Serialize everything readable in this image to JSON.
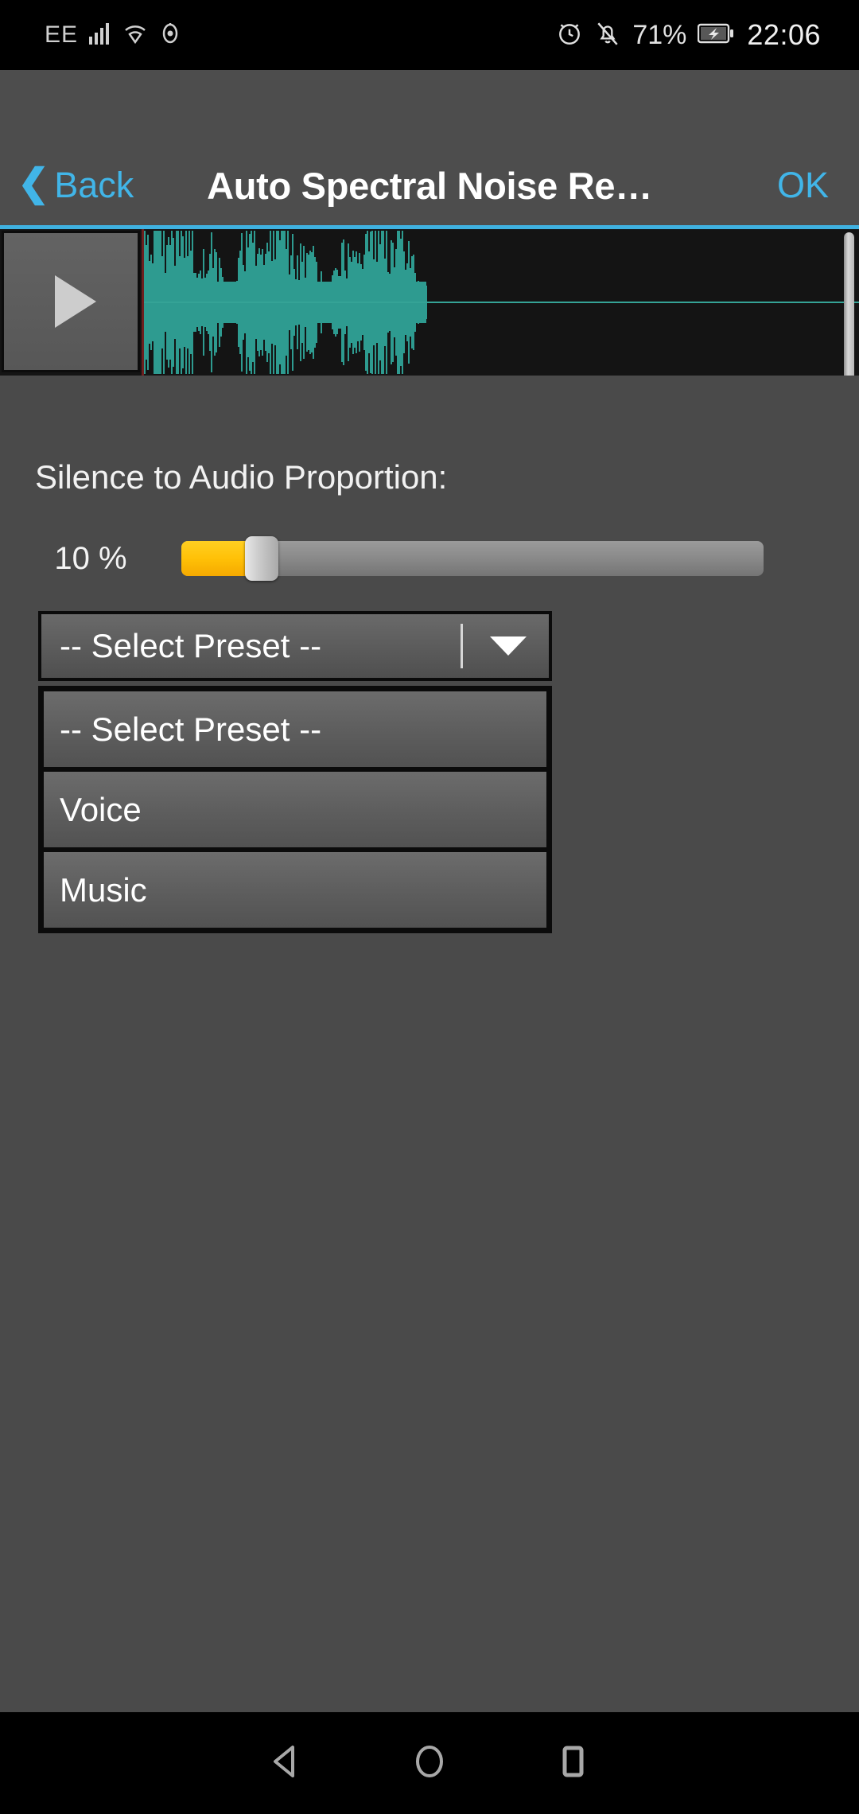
{
  "status_bar": {
    "carrier": "EE",
    "icons_left": [
      "signal-bars-icon",
      "wifi-icon",
      "eye-icon"
    ],
    "icons_right": [
      "alarm-clock-icon",
      "bell-muted-icon",
      "battery-charging-icon"
    ],
    "battery_percent": "71%",
    "clock": "22:06"
  },
  "header": {
    "back_label": "Back",
    "back_chevron": "❮",
    "title": "Auto Spectral Noise Re…",
    "ok_label": "OK",
    "accent_color": "#41b5e8",
    "background_color": "#4d4d4d",
    "divider_color": "#3fb1e0"
  },
  "waveform": {
    "play_icon": "play-icon",
    "background_color": "#141414",
    "wave_color": "#2e9b90",
    "center_line_color": "#35a396",
    "playhead_color": "#6d1f1f"
  },
  "slider": {
    "label": "Silence to Audio Proportion:",
    "value_text": "10 %",
    "value_percent": 10,
    "fill_color": "#ffc107",
    "track_color": "#8b8b8b",
    "thumb_color": "#cfcfcf"
  },
  "preset_spinner": {
    "selected_label": "-- Select Preset --",
    "arrow_icon": "chevron-down-icon",
    "options": [
      "-- Select Preset --",
      "Voice",
      "Music"
    ]
  },
  "nav_bar": {
    "back_icon": "nav-back-icon",
    "home_icon": "nav-home-icon",
    "recents_icon": "nav-recents-icon"
  },
  "page": {
    "background_color": "#4a4a4a"
  }
}
